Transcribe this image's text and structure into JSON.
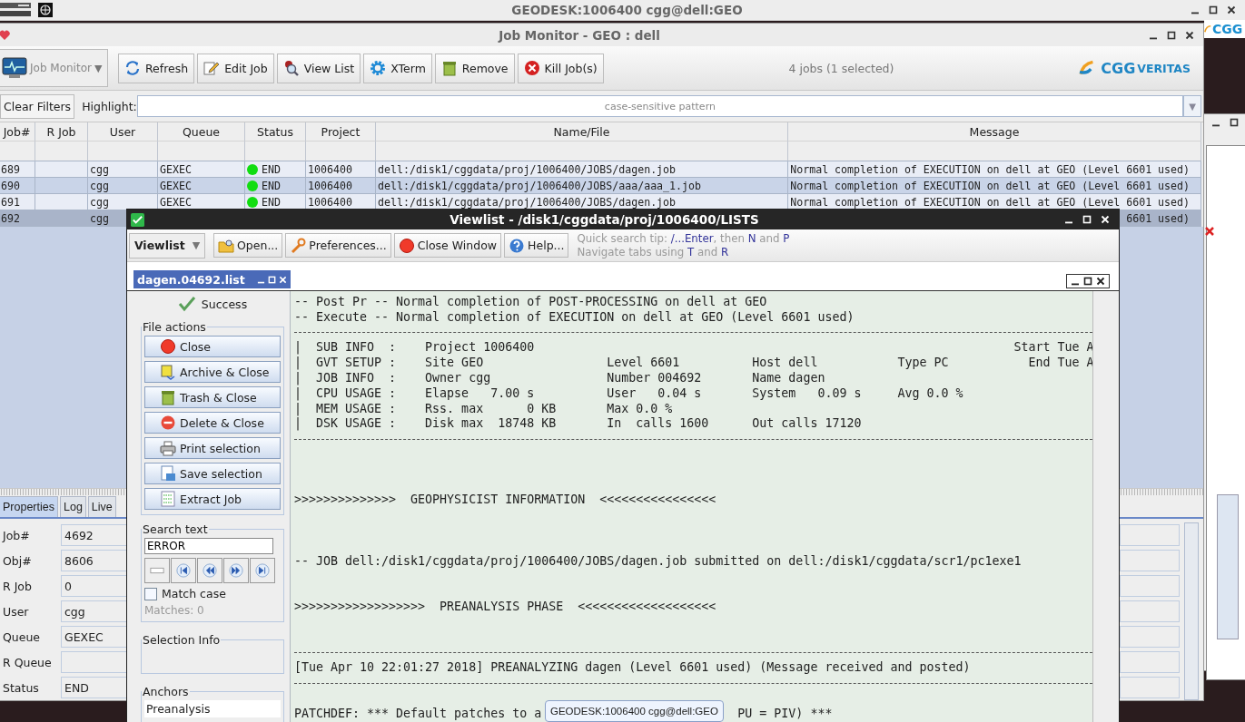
{
  "desktop": {
    "title": "GEODESK:1006400 cgg@dell:GEO",
    "corner_logo": "CGG",
    "tooltip": "GEODESK:1006400 cgg@dell:GEO"
  },
  "job_monitor": {
    "title": "Job Monitor - GEO : dell",
    "toolbar": {
      "menu": "Job Monitor",
      "menu_caret": "▼",
      "buttons": [
        {
          "label": "Refresh",
          "kind": "refresh"
        },
        {
          "label": "Edit Job",
          "kind": "edit"
        },
        {
          "label": "View List",
          "kind": "view"
        },
        {
          "label": "XTerm",
          "kind": "xterm"
        },
        {
          "label": "Remove",
          "kind": "remove"
        },
        {
          "label": "Kill Job(s)",
          "kind": "kill"
        }
      ],
      "summary": "4 jobs (1 selected)",
      "logo": {
        "brand": "CGG",
        "suffix": "VERITAS"
      }
    },
    "filters": {
      "clear": "Clear Filters",
      "highlight_label": "Highlight:",
      "placeholder": "case-sensitive pattern",
      "dropdown_caret": "▼"
    },
    "table": {
      "columns": [
        "Job#",
        "R Job",
        "User",
        "Queue",
        "Status",
        "Project",
        "Name/File",
        "Message"
      ],
      "rows": [
        {
          "job": "689",
          "user": "cgg",
          "queue": "GEXEC",
          "status": "END",
          "color": "#11dd11",
          "project": "1006400",
          "file": "dell:/disk1/cggdata/proj/1006400/JOBS/dagen.job",
          "message": "Normal completion of EXECUTION on dell at GEO (Level 6601 used)",
          "selected": false
        },
        {
          "job": "690",
          "user": "cgg",
          "queue": "GEXEC",
          "status": "END",
          "color": "#11dd11",
          "project": "1006400",
          "file": "dell:/disk1/cggdata/proj/1006400/JOBS/aaa/aaa_1.job",
          "message": "Normal completion of EXECUTION on dell at GEO (Level 6601 used)",
          "selected": false
        },
        {
          "job": "691",
          "user": "cgg",
          "queue": "GEXEC",
          "status": "END",
          "color": "#11dd11",
          "project": "1006400",
          "file": "dell:/disk1/cggdata/proj/1006400/JOBS/dagen.job",
          "message": "Normal completion of EXECUTION on dell at GEO (Level 6601 used)",
          "selected": false
        },
        {
          "job": "692",
          "user": "cgg",
          "message": "6601 used)",
          "selected": true
        }
      ]
    },
    "properties": {
      "tabs": [
        {
          "label": "Properties",
          "selected": true
        },
        {
          "label": "Log",
          "selected": false
        },
        {
          "label": "Live",
          "selected": false
        }
      ],
      "fields": [
        {
          "label": "Job#",
          "value": "4692"
        },
        {
          "label": "Obj#",
          "value": "8606"
        },
        {
          "label": "R Job",
          "value": "0"
        },
        {
          "label": "User",
          "value": "cgg"
        },
        {
          "label": "Queue",
          "value": "GEXEC"
        },
        {
          "label": "R Queue"
        },
        {
          "label": "Status",
          "value": "END"
        }
      ]
    }
  },
  "viewlist": {
    "title": "Viewlist - /disk1/cggdata/proj/1006400/LISTS",
    "toolbar": {
      "menu": "Viewlist",
      "menu_caret": "▼",
      "buttons": [
        {
          "label": "Open...",
          "kind": "open"
        },
        {
          "label": "Preferences...",
          "kind": "prefs"
        },
        {
          "label": "Close Window",
          "kind": "close_window"
        },
        {
          "label": "Help...",
          "kind": "help"
        }
      ],
      "tips": [
        [
          {
            "text": "Quick search tip: ",
            "key": false
          },
          {
            "text": "/...Enter",
            "key": true
          },
          {
            "text": ", then ",
            "key": false
          },
          {
            "text": "N",
            "key": true
          },
          {
            "text": " and ",
            "key": false
          },
          {
            "text": "P",
            "key": true
          }
        ],
        [
          {
            "text": "Navigate tabs using ",
            "key": false
          },
          {
            "text": "T",
            "key": true
          },
          {
            "text": " and ",
            "key": false
          },
          {
            "text": "R",
            "key": true
          }
        ]
      ]
    },
    "document": {
      "tab": "dagen.04692.list",
      "status": "Success",
      "file_actions": {
        "title": "File actions",
        "buttons": [
          {
            "label": "Close",
            "kind": "stop"
          },
          {
            "label": "Archive & Close",
            "kind": "archive"
          },
          {
            "label": "Trash & Close",
            "kind": "trash"
          },
          {
            "label": "Delete & Close",
            "kind": "delete"
          },
          {
            "label": "Print selection",
            "kind": "print"
          },
          {
            "label": "Save selection",
            "kind": "save"
          },
          {
            "label": "Extract Job",
            "kind": "extract"
          }
        ]
      },
      "search": {
        "title": "Search text",
        "value": "ERROR",
        "match_case": {
          "label": "Match case",
          "checked": false
        },
        "matches": "Matches: 0"
      },
      "selection_info": {
        "title": "Selection Info"
      },
      "anchors": {
        "title": "Anchors",
        "items": [
          {
            "label": "Preanalysis",
            "selected": false
          }
        ]
      },
      "log": [
        {
          "kind": "text",
          "text": "-- Post Pr -- Normal completion of POST-PROCESSING on dell at GEO"
        },
        {
          "kind": "text",
          "text": "-- Execute -- Normal completion of EXECUTION on dell at GEO (Level 6601 used)"
        },
        {
          "kind": "rule"
        },
        {
          "kind": "text",
          "text": "|  SUB INFO  :    Project 1006400                                                                  Start Tue A"
        },
        {
          "kind": "text",
          "text": "|  GVT SETUP :    Site GEO                 Level 6601          Host dell           Type PC           End Tue A"
        },
        {
          "kind": "text",
          "text": "|  JOB INFO  :    Owner cgg                Number 004692       Name dagen"
        },
        {
          "kind": "text",
          "text": "|  CPU USAGE :    Elapse   7.00 s          User   0.04 s       System   0.09 s     Avg 0.0 %"
        },
        {
          "kind": "text",
          "text": "|  MEM USAGE :    Rss. max      0 KB       Max 0.0 %"
        },
        {
          "kind": "text",
          "text": "|  DSK USAGE :    Disk max  18748 KB       In  calls 1600      Out calls 17120"
        },
        {
          "kind": "rule"
        },
        {
          "kind": "blank"
        },
        {
          "kind": "blank"
        },
        {
          "kind": "blank"
        },
        {
          "kind": "text",
          "text": ">>>>>>>>>>>>>>  GEOPHYSICIST INFORMATION  <<<<<<<<<<<<<<<<"
        },
        {
          "kind": "blank"
        },
        {
          "kind": "blank"
        },
        {
          "kind": "blank"
        },
        {
          "kind": "text",
          "text": "-- JOB dell:/disk1/cggdata/proj/1006400/JOBS/dagen.job submitted on dell:/disk1/cggdata/scr1/pc1exe1"
        },
        {
          "kind": "blank"
        },
        {
          "kind": "blank"
        },
        {
          "kind": "text",
          "text": ">>>>>>>>>>>>>>>>>>  PREANALYSIS PHASE  <<<<<<<<<<<<<<<<<<<"
        },
        {
          "kind": "blank"
        },
        {
          "kind": "blank"
        },
        {
          "kind": "rule"
        },
        {
          "kind": "text",
          "text": "[Tue Apr 10 22:01:27 2018] PREANALYZING dagen (Level 6601 used) (Message received and posted)"
        },
        {
          "kind": "rule"
        },
        {
          "kind": "blank"
        },
        {
          "kind": "split",
          "parts": [
            "PATCHDEF: *** Default patches to a",
            "PU = PIV) ***"
          ]
        }
      ]
    }
  }
}
